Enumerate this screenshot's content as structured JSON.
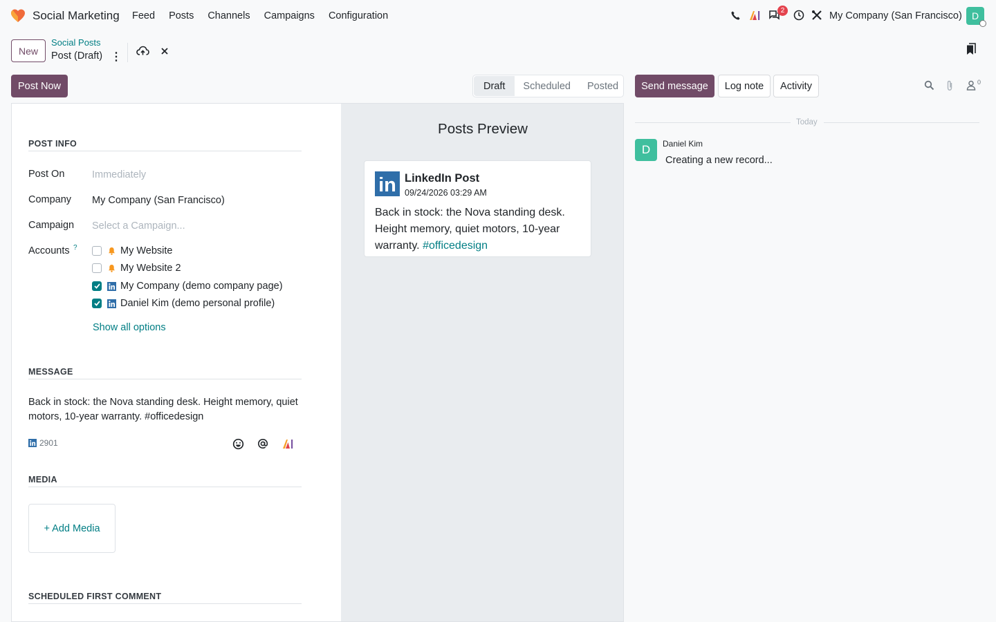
{
  "app": {
    "name": "Social Marketing"
  },
  "menu": [
    "Feed",
    "Posts",
    "Channels",
    "Campaigns",
    "Configuration"
  ],
  "systray": {
    "messages_badge": "2",
    "company": "My Company (San Francisco)",
    "avatar_initial": "D"
  },
  "control": {
    "new_label": "New",
    "breadcrumb_parent": "Social Posts",
    "breadcrumb_current": "Post (Draft)"
  },
  "actions": {
    "post_now": "Post Now"
  },
  "statusbar": {
    "stages": [
      "Draft",
      "Scheduled",
      "Posted"
    ],
    "active": "Draft"
  },
  "form": {
    "post_info_title": "POST INFO",
    "post_on": {
      "label": "Post On",
      "placeholder": "Immediately"
    },
    "company": {
      "label": "Company",
      "value": "My Company (San Francisco)"
    },
    "campaign": {
      "label": "Campaign",
      "placeholder": "Select a Campaign..."
    },
    "accounts": {
      "label": "Accounts",
      "help": "?",
      "items": [
        {
          "name": "My Website",
          "checked": false,
          "icon": "bell-icon"
        },
        {
          "name": "My Website 2",
          "checked": false,
          "icon": "bell-icon"
        },
        {
          "name": "My Company (demo company page)",
          "checked": true,
          "icon": "linkedin-icon"
        },
        {
          "name": "Daniel Kim (demo personal profile)",
          "checked": true,
          "icon": "linkedin-icon"
        }
      ],
      "show_all": "Show all options"
    },
    "message_title": "MESSAGE",
    "message": "Back in stock: the Nova standing desk. Height memory, quiet motors, 10-year warranty. #officedesign",
    "char_count": "2901",
    "media_title": "MEDIA",
    "add_media": "+ Add Media",
    "first_comment_title": "SCHEDULED FIRST COMMENT"
  },
  "preview": {
    "title": "Posts Preview",
    "card": {
      "logo_text": "in",
      "title": "LinkedIn Post",
      "date": "09/24/2026 03:29 AM",
      "body": "Back in stock: the Nova standing desk. Height memory, quiet motors, 10-year warranty. ",
      "hashtag": "#officedesign"
    }
  },
  "chatter": {
    "send_message": "Send message",
    "log_note": "Log note",
    "activity": "Activity",
    "followers_count": "0",
    "date_separator": "Today",
    "messages": [
      {
        "author": "Daniel Kim",
        "initial": "D",
        "text": "Creating a new record..."
      }
    ]
  },
  "colors": {
    "brand": "#714b67",
    "accent": "#017e84",
    "linkedin": "#2f6ea9",
    "avatar": "#3fbf9e"
  }
}
